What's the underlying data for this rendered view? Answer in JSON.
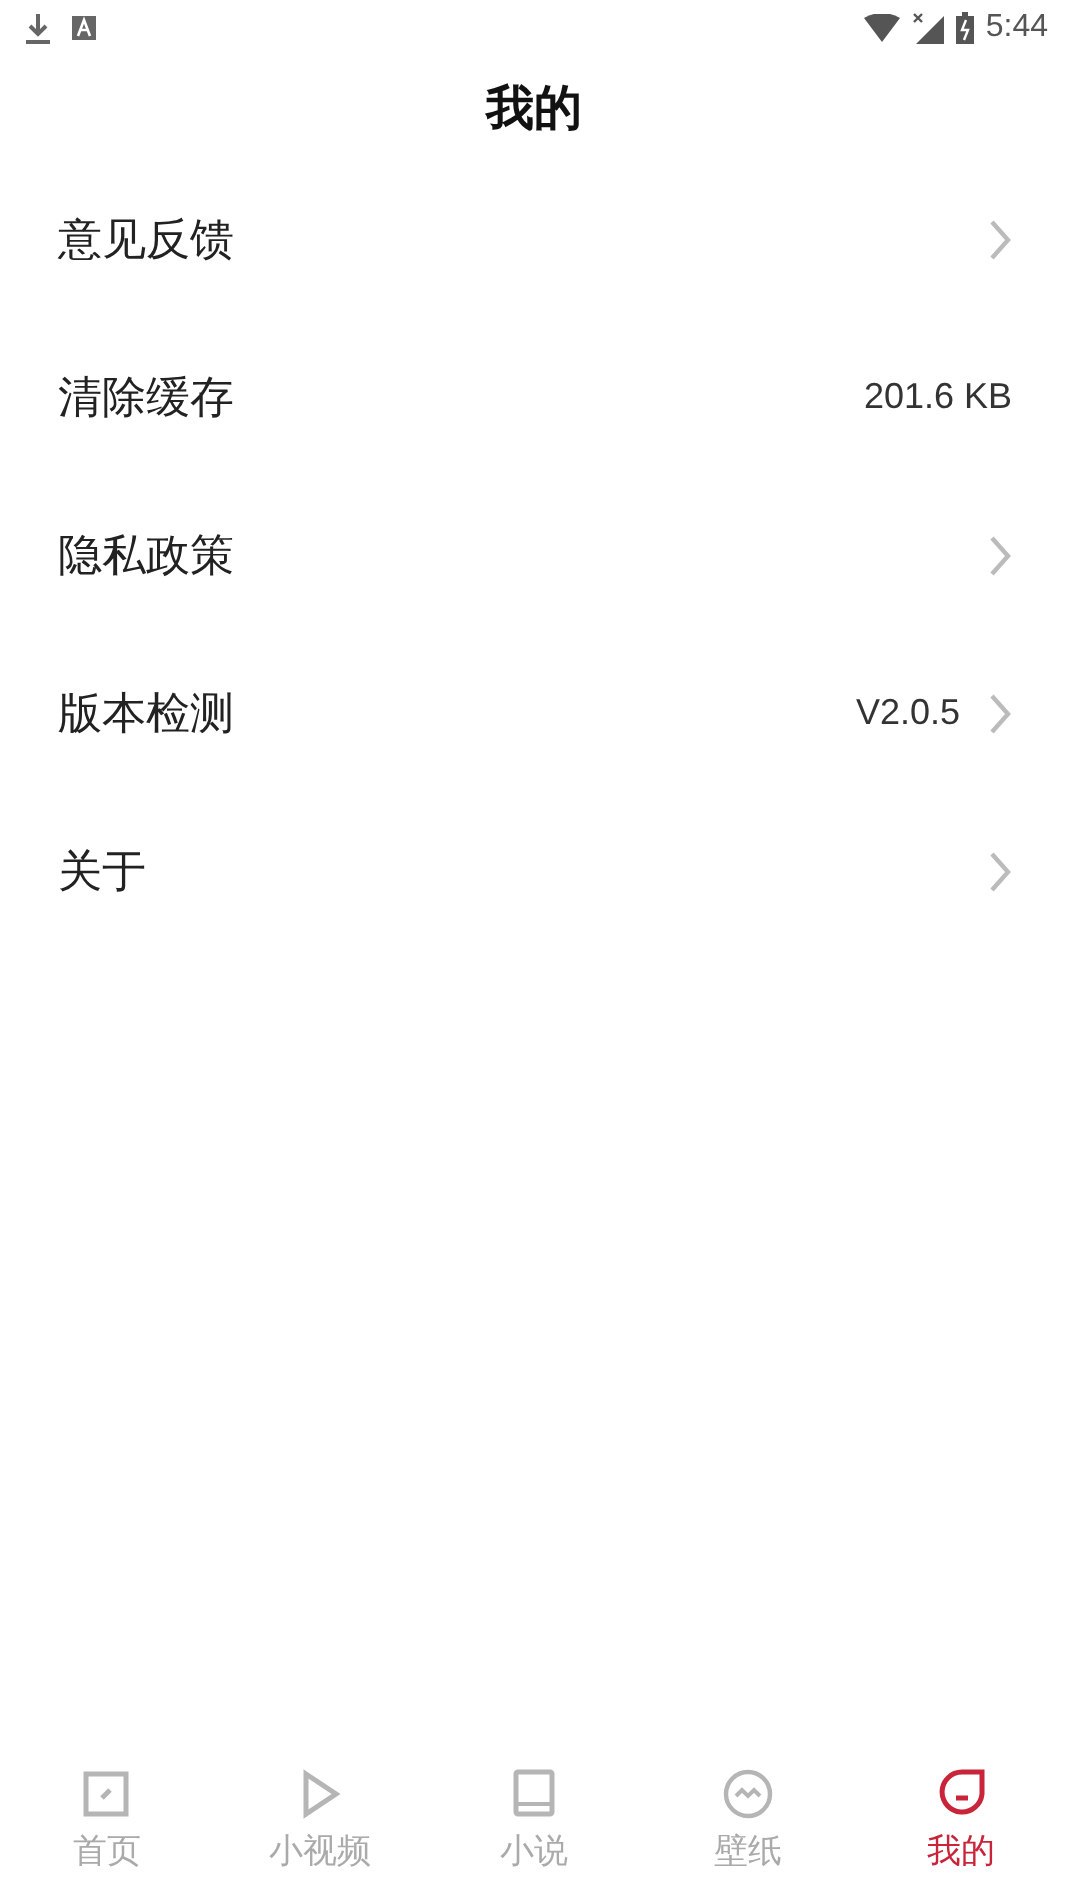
{
  "status_bar": {
    "time": "5:44"
  },
  "title": "我的",
  "menu_items": [
    {
      "label": "意见反馈",
      "chevron": true
    },
    {
      "label": "清除缓存",
      "value": "201.6 KB",
      "chevron": false
    },
    {
      "label": "隐私政策",
      "chevron": true
    },
    {
      "label": "版本检测",
      "value": "V2.0.5",
      "chevron": true
    },
    {
      "label": "关于",
      "chevron": true
    }
  ],
  "tabs": [
    {
      "label": "首页",
      "selected": false
    },
    {
      "label": "小视频",
      "selected": false
    },
    {
      "label": "小说",
      "selected": false
    },
    {
      "label": "壁纸",
      "selected": false
    },
    {
      "label": "我的",
      "selected": true
    }
  ]
}
